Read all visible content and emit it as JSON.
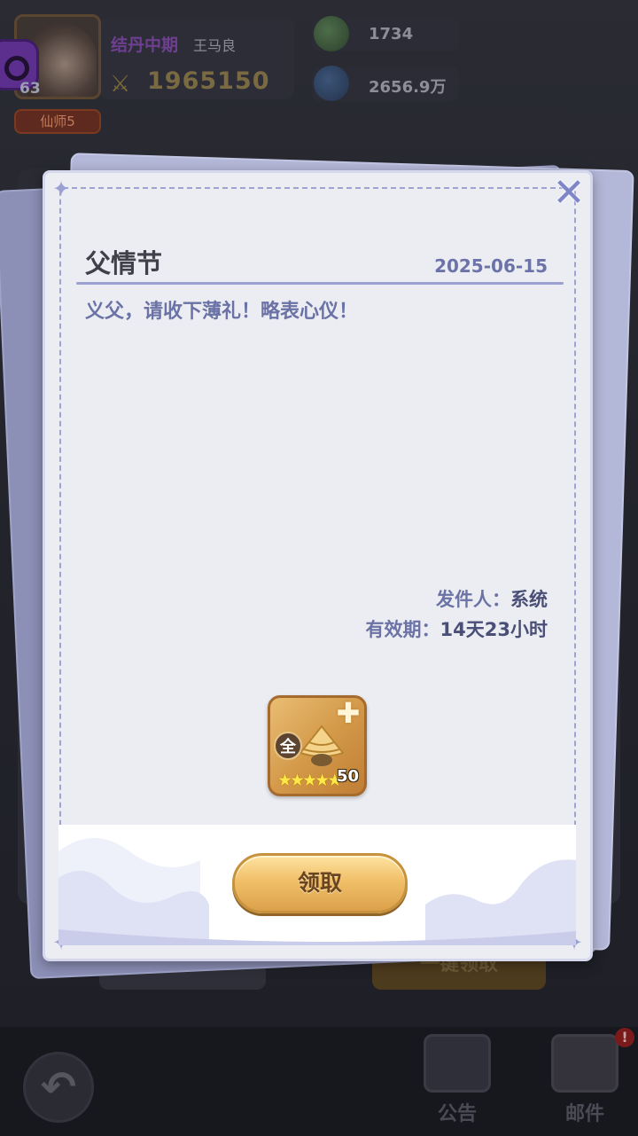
{
  "hud": {
    "level": "63",
    "rank": "仙师5",
    "realm": "结丹中期",
    "player_name": "王马良",
    "power": "1965150",
    "resources": [
      {
        "icon": "green-orb-plus-icon",
        "value": "1734"
      },
      {
        "icon": "blue-crystal-plus-icon",
        "value": "2656.9万"
      }
    ],
    "behind_button": "一键领取"
  },
  "mail": {
    "title": "父情节",
    "date": "2025-06-15",
    "body": "义父，请收下薄礼！略表心仪！",
    "sender_label": "发件人：",
    "sender": "系统",
    "expiry_label": "有效期：",
    "expiry": "14天23小时",
    "reward": {
      "badge": "全",
      "stars": 5,
      "count": "50",
      "icon": "straw-hat-icon"
    },
    "claim_label": "领取"
  },
  "nav": {
    "notice": "公告",
    "mail": "邮件",
    "mail_badge": "!"
  },
  "colors": {
    "accent": "#6a72a6",
    "dialog_bg": "#ecedf2",
    "button_gold": "#f1c06a"
  }
}
